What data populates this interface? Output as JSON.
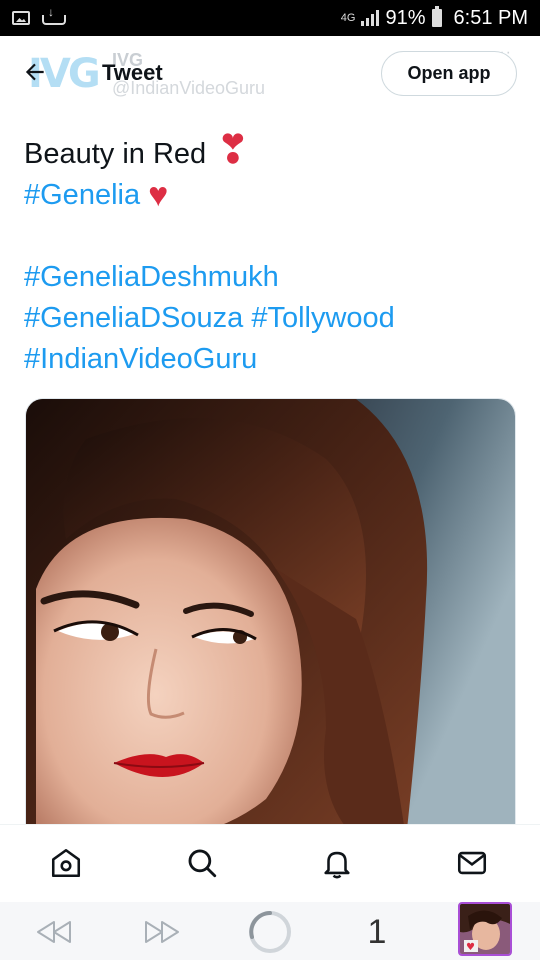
{
  "status_bar": {
    "network": "4G",
    "battery": "91%",
    "time": "6:51 PM",
    "icons": [
      "gallery-icon",
      "cloud-download-icon",
      "signal-icon",
      "battery-icon"
    ]
  },
  "header": {
    "title": "Tweet",
    "ghost_name": "IVG",
    "ghost_handle": "@IndianVideoGuru",
    "logo_text": "IVG",
    "open_app_label": "Open app",
    "more_label": "···"
  },
  "tweet": {
    "line1": "Beauty in Red",
    "line1_emoji": "❣",
    "line2_hashtag": "#Genelia",
    "line2_emoji": "♥",
    "line3": "#GeneliaDeshmukh",
    "line4a": "#GeneliaDSouza",
    "line4b": "#Tollywood",
    "line5": "#IndianVideoGuru"
  },
  "bottom_nav": {
    "items": [
      "home-icon",
      "search-icon",
      "notifications-icon",
      "messages-icon"
    ]
  },
  "browser_bar": {
    "tab_count": "1",
    "items": [
      "back-icon",
      "forward-icon",
      "reload-icon",
      "tabs-counter",
      "profile-thumbnail"
    ]
  },
  "colors": {
    "hashtag": "#1d9bf0",
    "text": "#0f1419",
    "emoji_red": "#dd2e44",
    "status_bar_bg": "#000000"
  }
}
